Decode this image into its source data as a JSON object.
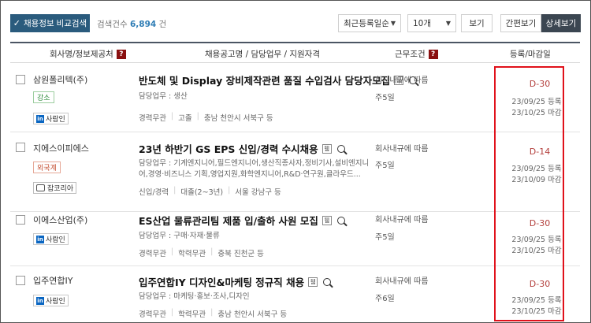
{
  "toolbar": {
    "compare_label": "채용정보 비교검색",
    "count_prefix": "검색건수",
    "count_value": "6,894",
    "count_suffix": "건",
    "sort_selected": "최근등록일순",
    "per_page_selected": "10개",
    "view_label": "보기",
    "simple_view_label": "간편보기",
    "detail_view_label": "상세보기"
  },
  "header": {
    "company": "회사명/정보제공처",
    "posting": "채용공고명 / 담당업무 / 지원자격",
    "conditions": "근무조건",
    "deadline": "등록/마감일",
    "help_mark": "?"
  },
  "rows": [
    {
      "company": "삼원폴리텍(주)",
      "badge": "강소",
      "source": "사람인",
      "title": "반도체 및 Display 장비제작관련 품질 수입검사 담당자모집",
      "duty": "담당업무 : 생산",
      "meta": [
        "경력무관",
        "고졸",
        "충남 천안시 서북구 등"
      ],
      "pay": "회사내규에 따름",
      "days": "주5일",
      "dday": "D-30",
      "registered": "23/09/25 등록",
      "deadline": "23/10/25 마감"
    },
    {
      "company": "지에스이피에스",
      "badge": "외국계",
      "source": "잡코리아",
      "title": "23년 하반기 GS EPS 신입/경력 수시채용",
      "duty": "담당업무 : 기계엔지니어,필드엔지니어,생산직종사자,정비기사,설비엔지니어,경영·비즈니스 기획,영업지원,화학엔지니어,R&D·연구원,클라우드...",
      "meta": [
        "신입/경력",
        "대졸(2~3년)",
        "서울 강남구 등"
      ],
      "pay": "회사내규에 따름",
      "days": "주5일",
      "dday": "D-14",
      "registered": "23/09/25 등록",
      "deadline": "23/10/09 마감"
    },
    {
      "company": "이에스산업(주)",
      "source": "사람인",
      "title": "ES산업 물류관리팀 제품 입/출하 사원 모집",
      "duty": "담당업무 : 구매·자재·물류",
      "meta": [
        "경력무관",
        "학력무관",
        "충북 진천군 등"
      ],
      "pay": "회사내규에 따름",
      "days": "주5일",
      "dday": "D-30",
      "registered": "23/09/25 등록",
      "deadline": "23/10/25 마감"
    },
    {
      "company": "입주연합IY",
      "source": "사람인",
      "title": "입주연합IY 디자인&마케팅 정규직 채용",
      "duty": "담당업무 : 마케팅·홍보·조사,디자인",
      "meta": [
        "경력무관",
        "학력무관",
        "충남 천안시 서북구 등"
      ],
      "pay": "회사내규에 따름",
      "days": "주6일",
      "dday": "D-30",
      "registered": "23/09/25 등록",
      "deadline": "23/10/25 마감"
    }
  ],
  "icons": {
    "check": "✓",
    "dropdown": "▼",
    "linkedin_letter": "in",
    "tag_glyph": "퉴"
  },
  "colors": {
    "compare_button": "#2a5b7d",
    "count_highlight": "#2f7db5",
    "dday": "#b4413e",
    "help_badge": "#8a1010",
    "highlight_box": "#e0111b"
  }
}
